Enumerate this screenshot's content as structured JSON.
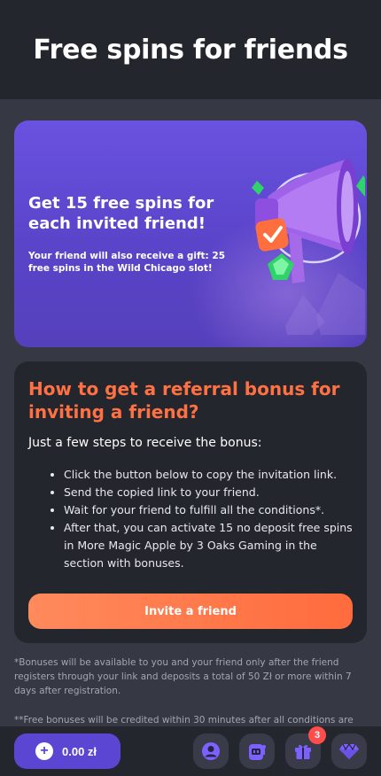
{
  "header": {
    "title": "Free spins for friends"
  },
  "promo": {
    "title": "Get 15 free spins for each invited friend!",
    "subtitle": "Your friend will also receive a gift: 25 free spins in the Wild Chicago slot!"
  },
  "howto": {
    "heading": "How to get a referral bonus for inviting a friend?",
    "lead": "Just a few steps to receive the bonus:",
    "steps": [
      "Click the button below to copy the invitation link.",
      "Send the copied link to your friend.",
      "Wait for your friend to fulfill all the conditions*.",
      "After that, you can activate 15 no deposit free spins in More Magic Apple by 3 Oaks Gaming in the section with bonuses."
    ],
    "button_label": "Invite a friend"
  },
  "notes": {
    "note1": "*Bonuses will be available to you and your friend only after the friend registers through your link and deposits a total of 50 Zł or more within 7 days after registration.",
    "note2": "**Free bonuses will be credited within 30 minutes after all conditions are"
  },
  "bottom_bar": {
    "balance": "0.00 zł",
    "gifts_badge": "3",
    "icons": [
      "plus-icon",
      "user-icon",
      "slot-machine-icon",
      "gift-icon",
      "diamond-icon"
    ]
  },
  "colors": {
    "accent_orange": "#ff6b3d",
    "accent_purple": "#5b46d4",
    "background": "#363944",
    "panel": "#24262e"
  }
}
